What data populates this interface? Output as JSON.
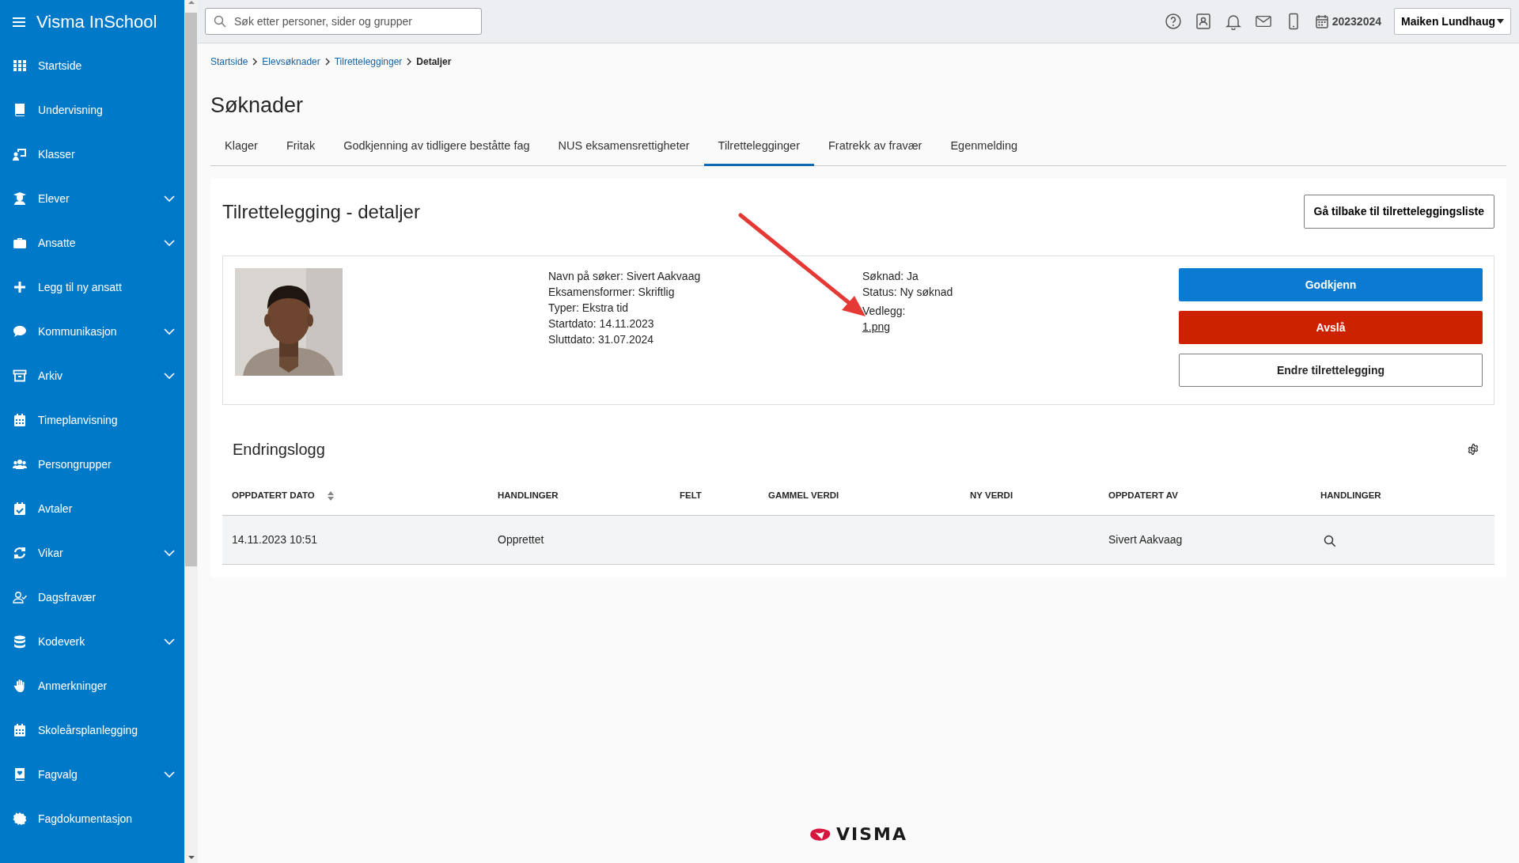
{
  "sidebar": {
    "brand": "Visma InSchool",
    "items": [
      {
        "label": "Startside",
        "has_submenu": false
      },
      {
        "label": "Undervisning",
        "has_submenu": false
      },
      {
        "label": "Klasser",
        "has_submenu": false
      },
      {
        "label": "Elever",
        "has_submenu": true
      },
      {
        "label": "Ansatte",
        "has_submenu": true
      },
      {
        "label": "Legg til ny ansatt",
        "has_submenu": false
      },
      {
        "label": "Kommunikasjon",
        "has_submenu": true
      },
      {
        "label": "Arkiv",
        "has_submenu": true
      },
      {
        "label": "Timeplanvisning",
        "has_submenu": false
      },
      {
        "label": "Persongrupper",
        "has_submenu": false
      },
      {
        "label": "Avtaler",
        "has_submenu": false
      },
      {
        "label": "Vikar",
        "has_submenu": true
      },
      {
        "label": "Dagsfravær",
        "has_submenu": false
      },
      {
        "label": "Kodeverk",
        "has_submenu": true
      },
      {
        "label": "Anmerkninger",
        "has_submenu": false
      },
      {
        "label": "Skoleårsplanlegging",
        "has_submenu": false
      },
      {
        "label": "Fagvalg",
        "has_submenu": true
      },
      {
        "label": "Fagdokumentasjon",
        "has_submenu": false
      }
    ]
  },
  "topbar": {
    "search": {
      "placeholder": "Søk etter personer, sider og grupper"
    },
    "school_year": "20232024",
    "user": "Maiken Lundhaug"
  },
  "breadcrumb": [
    {
      "label": "Startside",
      "current": false
    },
    {
      "label": "Elevsøknader",
      "current": false
    },
    {
      "label": "Tilrettelegginger",
      "current": false
    },
    {
      "label": "Detaljer",
      "current": true
    }
  ],
  "page_title": "Søknader",
  "tabs": [
    {
      "label": "Klager",
      "selected": false
    },
    {
      "label": "Fritak",
      "selected": false
    },
    {
      "label": "Godkjenning av tidligere beståtte fag",
      "selected": false
    },
    {
      "label": "NUS eksamensrettigheter",
      "selected": false
    },
    {
      "label": "Tilrettelegginger",
      "selected": true
    },
    {
      "label": "Fratrekk av fravær",
      "selected": false
    },
    {
      "label": "Egenmelding",
      "selected": false
    }
  ],
  "details": {
    "title": "Tilrettelegging - detaljer",
    "back_button": "Gå tilbake til tilretteleggingsliste",
    "photo": {
      "kind": "picture"
    },
    "info_left": [
      "Navn på søker: Sivert Aakvaag",
      "Eksamensformer: Skriftlig",
      "Typer: Ekstra tid",
      "Startdato: 14.11.2023",
      "Sluttdato: 31.07.2024"
    ],
    "info_right": [
      "Søknad: Ja",
      "Status: Ny søknad"
    ],
    "attachment_label": "Vedlegg:",
    "attachment": "1.png",
    "actions": [
      {
        "label": "Godkjenn",
        "kind": "primary"
      },
      {
        "label": "Avslå",
        "kind": "danger"
      },
      {
        "label": "Endre tilrettelegging",
        "kind": "outline"
      }
    ]
  },
  "changelog": {
    "title": "Endringslogg",
    "columns": [
      {
        "label": "OPPDATERT DATO",
        "sortable": true
      },
      {
        "label": "HANDLINGER",
        "sortable": false
      },
      {
        "label": "FELT",
        "sortable": false
      },
      {
        "label": "GAMMEL VERDI",
        "sortable": false
      },
      {
        "label": "NY VERDI",
        "sortable": false
      },
      {
        "label": "OPPDATERT AV",
        "sortable": false
      },
      {
        "label": "HANDLINGER",
        "sortable": false
      }
    ],
    "rows": [
      {
        "cells": [
          {
            "kind": "text",
            "text": "14.11.2023 10:51"
          },
          {
            "kind": "text",
            "text": "Opprettet"
          },
          {
            "kind": "empty"
          },
          {
            "kind": "empty"
          },
          {
            "kind": "empty"
          },
          {
            "kind": "text",
            "text": "Sivert Aakvaag"
          },
          {
            "kind": "view"
          }
        ]
      }
    ]
  },
  "footer": {
    "logo": "VISMA"
  }
}
